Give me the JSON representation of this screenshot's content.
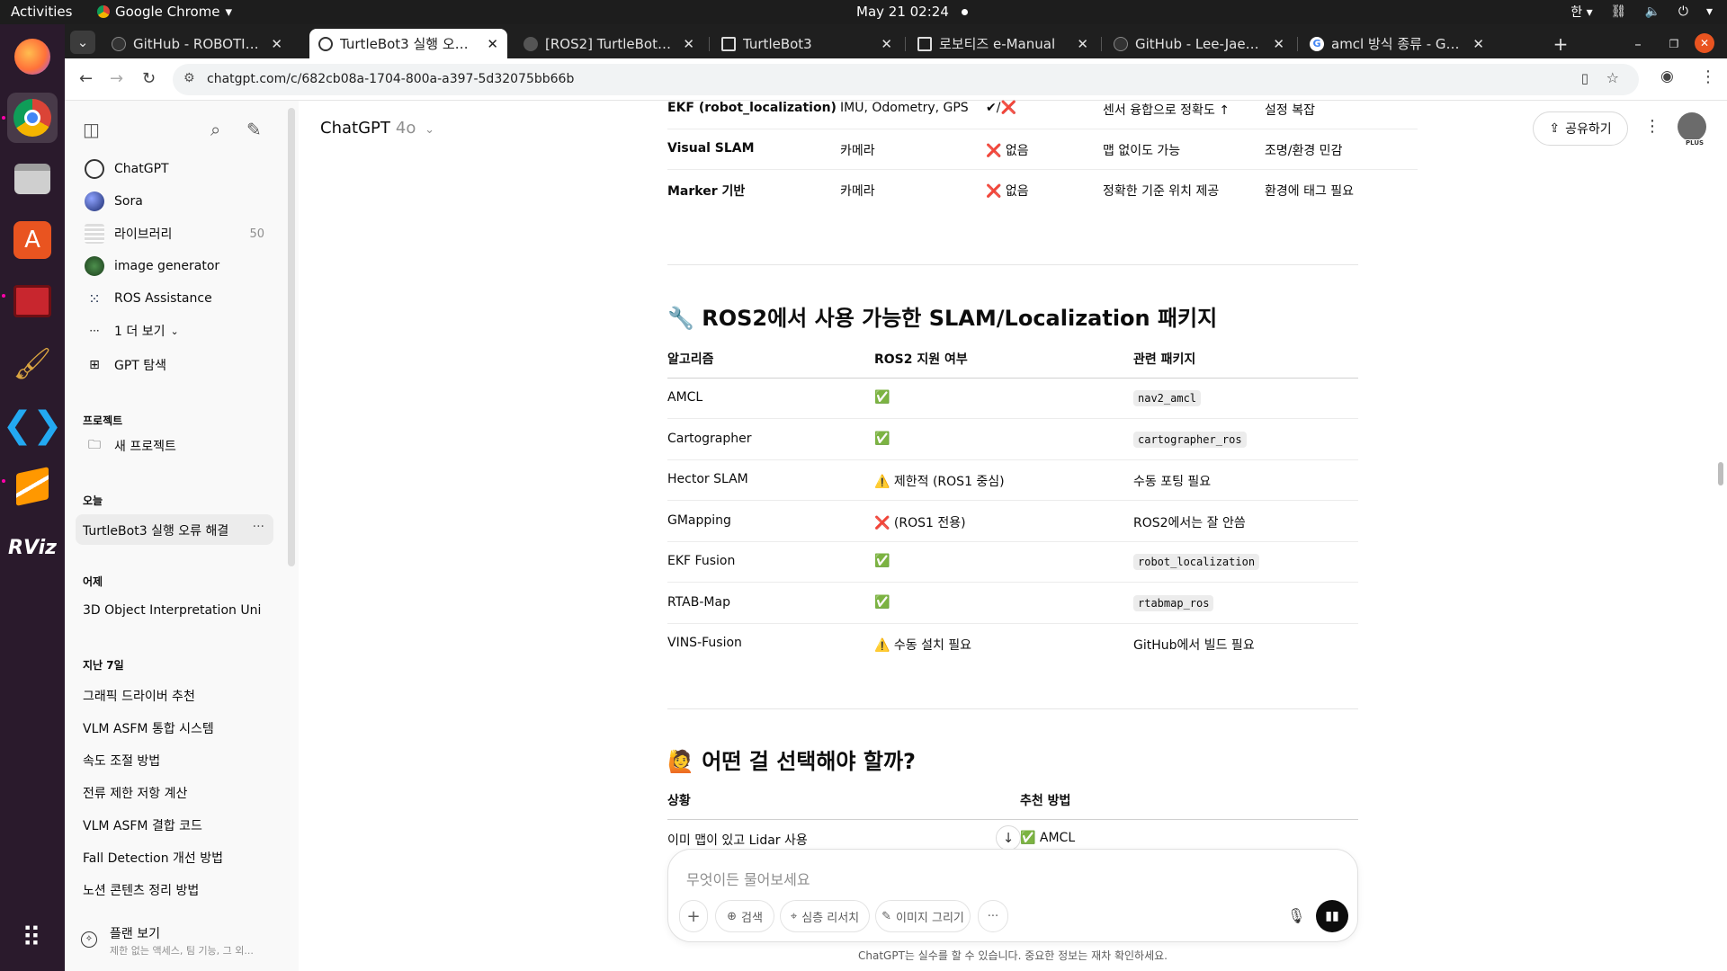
{
  "os": {
    "activities": "Activities",
    "app_name": "Google Chrome",
    "clock": "May 21  02:24",
    "input_method": "한"
  },
  "tabs": [
    {
      "title": "GitHub - ROBOTIS-GIT/..."
    },
    {
      "title": "TurtleBot3 실행 오류 해..."
    },
    {
      "title": "[ROS2] TurtleBot3+ROS..."
    },
    {
      "title": "TurtleBot3"
    },
    {
      "title": "로보티즈 e-Manual"
    },
    {
      "title": "GitHub - Lee-JaeWon/..."
    },
    {
      "title": "amcl 방식 종류 - Google..."
    }
  ],
  "address": {
    "url": "chatgpt.com/c/682cb08a-1704-800a-a397-5d32075bb66b"
  },
  "sidebar": {
    "items": [
      {
        "label": "ChatGPT"
      },
      {
        "label": "Sora"
      },
      {
        "label": "라이브러리",
        "count": "50"
      },
      {
        "label": "image generator"
      },
      {
        "label": "ROS Assistance"
      },
      {
        "label": "1 더 보기"
      },
      {
        "label": "GPT 탐색"
      }
    ],
    "projects_heading": "프로젝트",
    "new_project": "새 프로젝트",
    "today_heading": "오늘",
    "today_chat": "TurtleBot3 실행 오류 해결",
    "yesterday_heading": "어제",
    "yesterday_chat": "3D Object Interpretation Uni",
    "week_heading": "지난 7일",
    "week_chats": [
      "그래픽 드라이버 추천",
      "VLM ASFM 통합 시스템",
      "속도 조절 방법",
      "전류 제한 저항 계산",
      "VLM ASFM 결합 코드",
      "Fall Detection 개선 방법",
      "노션 콘텐츠 정리 방법"
    ],
    "plan_title": "플랜 보기",
    "plan_desc": "제한 없는 액세스, 팀 기능, 그 외..."
  },
  "header": {
    "model": "ChatGPT",
    "version": "4o",
    "share": "공유하기"
  },
  "table1_rows": [
    {
      "name": "EKF (robot_localization)",
      "input": "IMU, Odometry, GPS",
      "map": "✔/❌",
      "pro": "센서 융합으로 정확도 ↑",
      "con": "설정 복잡"
    },
    {
      "name": "Visual SLAM",
      "input": "카메라",
      "map": "❌ 없음",
      "pro": "맵 없이도 가능",
      "con": "조명/환경 민감"
    },
    {
      "name": "Marker 기반",
      "input": "카메라",
      "map": "❌ 없음",
      "pro": "정확한 기준 위치 제공",
      "con": "환경에 태그 필요"
    }
  ],
  "section2": {
    "title": "🔧 ROS2에서 사용 가능한 SLAM/Localization 패키지",
    "headers": [
      "알고리즘",
      "ROS2 지원 여부",
      "관련 패키지"
    ],
    "rows": [
      {
        "algo": "AMCL",
        "support": "✅",
        "pkg": "nav2_amcl",
        "code": true
      },
      {
        "algo": "Cartographer",
        "support": "✅",
        "pkg": "cartographer_ros",
        "code": true
      },
      {
        "algo": "Hector SLAM",
        "support": "⚠️ 제한적 (ROS1 중심)",
        "pkg": "수동 포팅 필요",
        "code": false
      },
      {
        "algo": "GMapping",
        "support": "❌ (ROS1 전용)",
        "pkg": "ROS2에서는 잘 안씀",
        "code": false
      },
      {
        "algo": "EKF Fusion",
        "support": "✅",
        "pkg": "robot_localization",
        "code": true
      },
      {
        "algo": "RTAB-Map",
        "support": "✅",
        "pkg": "rtabmap_ros",
        "code": true
      },
      {
        "algo": "VINS-Fusion",
        "support": "⚠️ 수동 설치 필요",
        "pkg": "GitHub에서 빌드 필요",
        "code": false
      }
    ]
  },
  "section3": {
    "title": "🙋 어떤 걸 선택해야 할까?",
    "headers": [
      "상황",
      "추천 방법"
    ],
    "rows": [
      {
        "situation": "이미 맵이 있고 Lidar 사용",
        "rec": "✅ AMCL"
      }
    ]
  },
  "composer": {
    "placeholder": "무엇이든 물어보세요",
    "search": "검색",
    "deep_research": "심층 리서치",
    "image": "이미지 그리기"
  },
  "disclaimer": "ChatGPT는 실수를 할 수 있습니다. 중요한 정보는 재차 확인하세요.",
  "colors": {
    "accent": "#0d0d0d",
    "ok_green": "#3da73d",
    "no_red": "#e0261a",
    "warn_amber": "#e7a300"
  }
}
